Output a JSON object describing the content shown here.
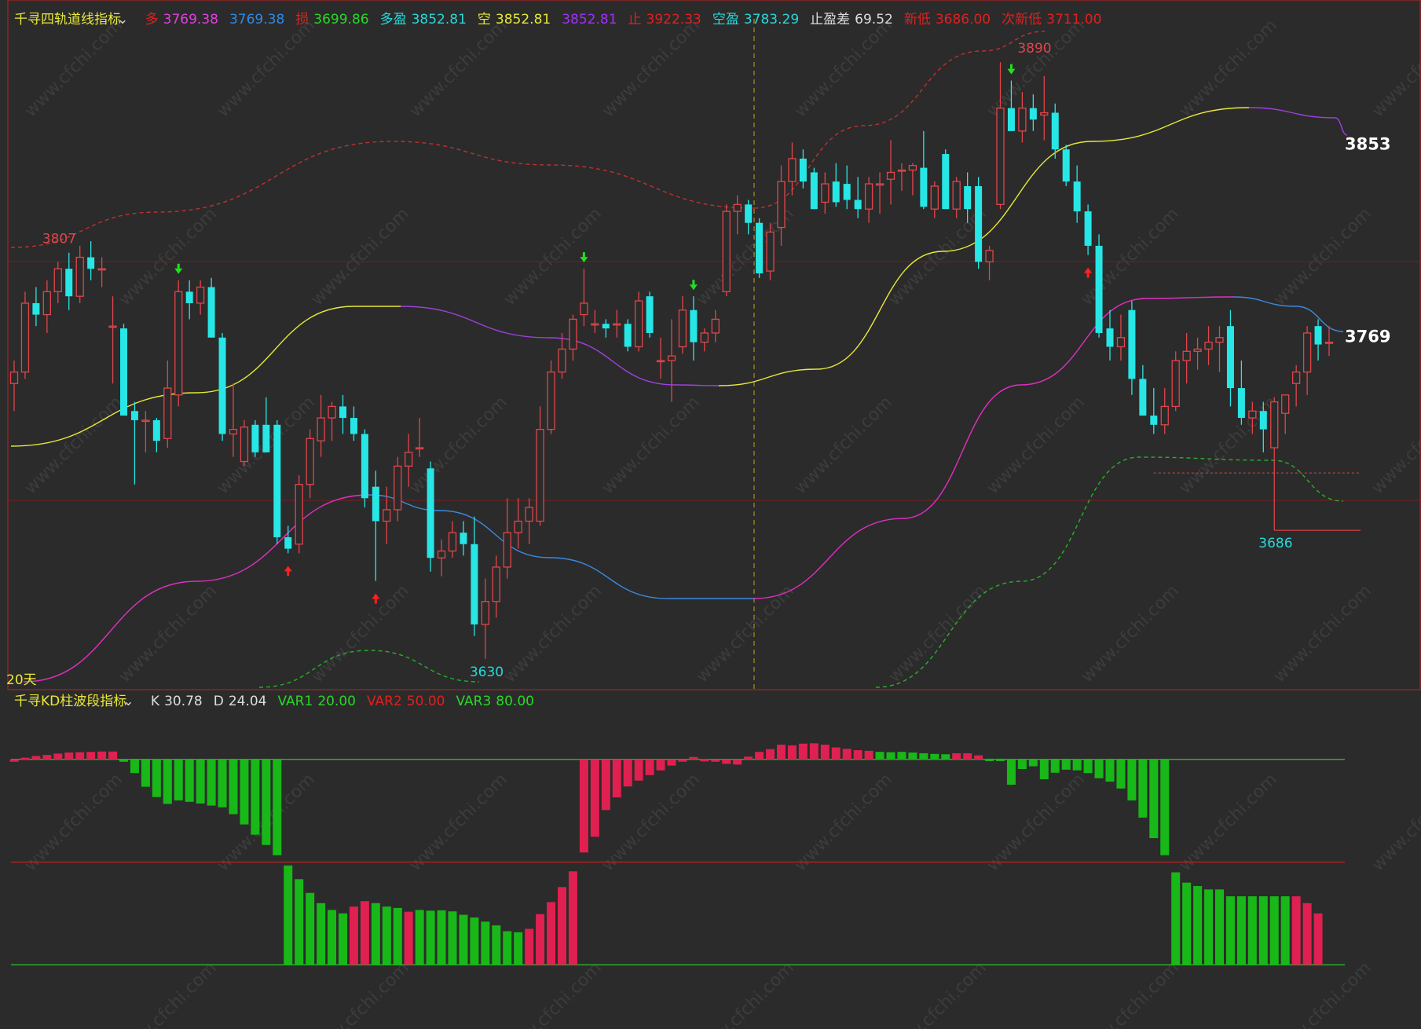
{
  "main_header": {
    "indicator_name": "千寻四轨道线指标",
    "values": [
      {
        "label": "多",
        "value": "3769.38",
        "label_color": "#e02020",
        "value_color": "#e040e0"
      },
      {
        "label": "",
        "value": "3769.38",
        "label_color": "#e02020",
        "value_color": "#2e8ae6"
      },
      {
        "label": "损",
        "value": "3699.86",
        "label_color": "#e02020",
        "value_color": "#27d927"
      },
      {
        "label": "多盈",
        "value": "3852.81",
        "label_color": "#27d9d9",
        "value_color": "#27d9d9"
      },
      {
        "label": "空",
        "value": "3852.81",
        "label_color": "#e8e83a",
        "value_color": "#e8e83a"
      },
      {
        "label": "",
        "value": "3852.81",
        "label_color": "#a030ff",
        "value_color": "#a030ff"
      },
      {
        "label": "止",
        "value": "3922.33",
        "label_color": "#e02020",
        "value_color": "#e02020"
      },
      {
        "label": "空盈",
        "value": "3783.29",
        "label_color": "#27d9d9",
        "value_color": "#27d9d9"
      },
      {
        "label": "止盈差",
        "value": "69.52",
        "label_color": "#dddddd",
        "value_color": "#dddddd"
      },
      {
        "label": "新低",
        "value": "3686.00",
        "label_color": "#e02020",
        "value_color": "#e02020"
      },
      {
        "label": "次新低",
        "value": "3711.00",
        "label_color": "#e02020",
        "value_color": "#e02020"
      }
    ]
  },
  "kd_header": {
    "indicator_name": "千寻KD柱波段指标",
    "values": [
      {
        "label": "K",
        "value": "30.78",
        "label_color": "#dddddd",
        "value_color": "#dddddd"
      },
      {
        "label": "D",
        "value": "24.04",
        "label_color": "#dddddd",
        "value_color": "#dddddd"
      },
      {
        "label": "VAR1",
        "value": "20.00",
        "label_color": "#27d927",
        "value_color": "#27d927"
      },
      {
        "label": "VAR2",
        "value": "50.00",
        "label_color": "#e02020",
        "value_color": "#e02020"
      },
      {
        "label": "VAR3",
        "value": "80.00",
        "label_color": "#27d927",
        "value_color": "#27d927"
      }
    ]
  },
  "watermark": "www.cfchi.com",
  "colors": {
    "background": "#2b2b2b",
    "up_candle": "#e0454a",
    "down_candle": "#27e6e6",
    "kd_up": "#e02050",
    "kd_down": "#18b818",
    "grid_red": "#7a1f1f",
    "yellow_line": "#e8e83a",
    "purple_line": "#a040e0",
    "blue_line": "#3a8ae0",
    "magenta_line": "#e030c0",
    "dash_red": "#c03030",
    "dash_green": "#28b028",
    "buy_arrow": "#ff2020",
    "sell_arrow": "#20e020"
  },
  "chart_data": [
    {
      "type": "candlestick",
      "price_range": [
        3620,
        3900
      ],
      "period_label": "20天",
      "price_labels": [
        {
          "text": "3807",
          "index": 4,
          "price": 3807,
          "color": "#e0454a"
        },
        {
          "text": "3630",
          "index": 43,
          "price": 3630,
          "color": "#27d9d9"
        },
        {
          "text": "3890",
          "index": 93,
          "price": 3890,
          "color": "#e0454a"
        },
        {
          "text": "3686",
          "index": 115,
          "price": 3686,
          "color": "#27d9d9"
        }
      ],
      "right_labels": [
        {
          "text": "3853",
          "price": 3853
        },
        {
          "text": "3769",
          "price": 3769
        }
      ],
      "candles": [
        {
          "o": 3750,
          "h": 3760,
          "l": 3738,
          "c": 3755
        },
        {
          "o": 3755,
          "h": 3790,
          "l": 3752,
          "c": 3785
        },
        {
          "o": 3785,
          "h": 3792,
          "l": 3775,
          "c": 3780
        },
        {
          "o": 3780,
          "h": 3795,
          "l": 3772,
          "c": 3790
        },
        {
          "o": 3790,
          "h": 3803,
          "l": 3785,
          "c": 3800
        },
        {
          "o": 3800,
          "h": 3807,
          "l": 3782,
          "c": 3788
        },
        {
          "o": 3788,
          "h": 3810,
          "l": 3785,
          "c": 3805
        },
        {
          "o": 3805,
          "h": 3812,
          "l": 3795,
          "c": 3800
        },
        {
          "o": 3800,
          "h": 3805,
          "l": 3792,
          "c": 3800
        },
        {
          "o": 3775,
          "h": 3788,
          "l": 3750,
          "c": 3775
        },
        {
          "o": 3774,
          "h": 3776,
          "l": 3738,
          "c": 3736
        },
        {
          "o": 3738,
          "h": 3742,
          "l": 3706,
          "c": 3734
        },
        {
          "o": 3734,
          "h": 3738,
          "l": 3720,
          "c": 3734
        },
        {
          "o": 3734,
          "h": 3735,
          "l": 3720,
          "c": 3725
        },
        {
          "o": 3726,
          "h": 3760,
          "l": 3722,
          "c": 3748
        },
        {
          "o": 3745,
          "h": 3795,
          "l": 3740,
          "c": 3790
        },
        {
          "o": 3790,
          "h": 3795,
          "l": 3778,
          "c": 3785
        },
        {
          "o": 3785,
          "h": 3795,
          "l": 3780,
          "c": 3792
        },
        {
          "o": 3792,
          "h": 3796,
          "l": 3770,
          "c": 3770
        },
        {
          "o": 3770,
          "h": 3772,
          "l": 3725,
          "c": 3728
        },
        {
          "o": 3728,
          "h": 3750,
          "l": 3718,
          "c": 3730
        },
        {
          "o": 3716,
          "h": 3734,
          "l": 3714,
          "c": 3731
        },
        {
          "o": 3732,
          "h": 3734,
          "l": 3718,
          "c": 3720
        },
        {
          "o": 3732,
          "h": 3744,
          "l": 3720,
          "c": 3720
        },
        {
          "o": 3732,
          "h": 3734,
          "l": 3680,
          "c": 3683
        },
        {
          "o": 3683,
          "h": 3688,
          "l": 3676,
          "c": 3678
        },
        {
          "o": 3680,
          "h": 3710,
          "l": 3676,
          "c": 3706
        },
        {
          "o": 3706,
          "h": 3730,
          "l": 3700,
          "c": 3726
        },
        {
          "o": 3725,
          "h": 3745,
          "l": 3718,
          "c": 3735
        },
        {
          "o": 3735,
          "h": 3742,
          "l": 3725,
          "c": 3740
        },
        {
          "o": 3740,
          "h": 3745,
          "l": 3728,
          "c": 3735
        },
        {
          "o": 3735,
          "h": 3740,
          "l": 3725,
          "c": 3728
        },
        {
          "o": 3728,
          "h": 3730,
          "l": 3696,
          "c": 3700
        },
        {
          "o": 3705,
          "h": 3712,
          "l": 3664,
          "c": 3690
        },
        {
          "o": 3690,
          "h": 3705,
          "l": 3680,
          "c": 3695
        },
        {
          "o": 3695,
          "h": 3718,
          "l": 3690,
          "c": 3714
        },
        {
          "o": 3714,
          "h": 3728,
          "l": 3705,
          "c": 3720
        },
        {
          "o": 3722,
          "h": 3735,
          "l": 3718,
          "c": 3722
        },
        {
          "o": 3713,
          "h": 3716,
          "l": 3668,
          "c": 3674
        },
        {
          "o": 3674,
          "h": 3682,
          "l": 3666,
          "c": 3677
        },
        {
          "o": 3677,
          "h": 3690,
          "l": 3674,
          "c": 3685
        },
        {
          "o": 3685,
          "h": 3690,
          "l": 3675,
          "c": 3680
        },
        {
          "o": 3680,
          "h": 3692,
          "l": 3640,
          "c": 3645
        },
        {
          "o": 3645,
          "h": 3665,
          "l": 3630,
          "c": 3655
        },
        {
          "o": 3655,
          "h": 3675,
          "l": 3648,
          "c": 3670
        },
        {
          "o": 3670,
          "h": 3700,
          "l": 3665,
          "c": 3685
        },
        {
          "o": 3685,
          "h": 3700,
          "l": 3678,
          "c": 3690
        },
        {
          "o": 3690,
          "h": 3700,
          "l": 3680,
          "c": 3696
        },
        {
          "o": 3690,
          "h": 3740,
          "l": 3688,
          "c": 3730
        },
        {
          "o": 3730,
          "h": 3760,
          "l": 3728,
          "c": 3755
        },
        {
          "o": 3755,
          "h": 3772,
          "l": 3752,
          "c": 3765
        },
        {
          "o": 3765,
          "h": 3780,
          "l": 3760,
          "c": 3778
        },
        {
          "o": 3780,
          "h": 3800,
          "l": 3775,
          "c": 3785
        },
        {
          "o": 3776,
          "h": 3782,
          "l": 3772,
          "c": 3776
        },
        {
          "o": 3776,
          "h": 3778,
          "l": 3770,
          "c": 3774
        },
        {
          "o": 3776,
          "h": 3782,
          "l": 3770,
          "c": 3776
        },
        {
          "o": 3776,
          "h": 3778,
          "l": 3764,
          "c": 3766
        },
        {
          "o": 3766,
          "h": 3790,
          "l": 3764,
          "c": 3786
        },
        {
          "o": 3788,
          "h": 3790,
          "l": 3770,
          "c": 3772
        },
        {
          "o": 3760,
          "h": 3770,
          "l": 3752,
          "c": 3760
        },
        {
          "o": 3760,
          "h": 3778,
          "l": 3742,
          "c": 3762
        },
        {
          "o": 3766,
          "h": 3788,
          "l": 3763,
          "c": 3782
        },
        {
          "o": 3782,
          "h": 3788,
          "l": 3760,
          "c": 3768
        },
        {
          "o": 3768,
          "h": 3774,
          "l": 3764,
          "c": 3772
        },
        {
          "o": 3772,
          "h": 3782,
          "l": 3768,
          "c": 3778
        },
        {
          "o": 3790,
          "h": 3828,
          "l": 3788,
          "c": 3825
        },
        {
          "o": 3825,
          "h": 3832,
          "l": 3815,
          "c": 3828
        },
        {
          "o": 3828,
          "h": 3830,
          "l": 3815,
          "c": 3820
        },
        {
          "o": 3820,
          "h": 3822,
          "l": 3796,
          "c": 3798
        },
        {
          "o": 3799,
          "h": 3820,
          "l": 3795,
          "c": 3816
        },
        {
          "o": 3818,
          "h": 3845,
          "l": 3810,
          "c": 3838
        },
        {
          "o": 3838,
          "h": 3855,
          "l": 3832,
          "c": 3848
        },
        {
          "o": 3848,
          "h": 3852,
          "l": 3835,
          "c": 3838
        },
        {
          "o": 3842,
          "h": 3844,
          "l": 3826,
          "c": 3826
        },
        {
          "o": 3829,
          "h": 3842,
          "l": 3824,
          "c": 3837
        },
        {
          "o": 3838,
          "h": 3846,
          "l": 3827,
          "c": 3829
        },
        {
          "o": 3837,
          "h": 3845,
          "l": 3826,
          "c": 3830
        },
        {
          "o": 3830,
          "h": 3840,
          "l": 3822,
          "c": 3826
        },
        {
          "o": 3826,
          "h": 3840,
          "l": 3820,
          "c": 3837
        },
        {
          "o": 3837,
          "h": 3842,
          "l": 3824,
          "c": 3837
        },
        {
          "o": 3839,
          "h": 3856,
          "l": 3828,
          "c": 3842
        },
        {
          "o": 3843,
          "h": 3846,
          "l": 3834,
          "c": 3843
        },
        {
          "o": 3843,
          "h": 3846,
          "l": 3832,
          "c": 3845
        },
        {
          "o": 3844,
          "h": 3860,
          "l": 3826,
          "c": 3827
        },
        {
          "o": 3826,
          "h": 3838,
          "l": 3822,
          "c": 3836
        },
        {
          "o": 3850,
          "h": 3852,
          "l": 3826,
          "c": 3826
        },
        {
          "o": 3826,
          "h": 3840,
          "l": 3822,
          "c": 3838
        },
        {
          "o": 3836,
          "h": 3842,
          "l": 3820,
          "c": 3826
        },
        {
          "o": 3836,
          "h": 3840,
          "l": 3800,
          "c": 3803
        },
        {
          "o": 3803,
          "h": 3810,
          "l": 3795,
          "c": 3808
        },
        {
          "o": 3828,
          "h": 3890,
          "l": 3826,
          "c": 3870
        },
        {
          "o": 3870,
          "h": 3882,
          "l": 3860,
          "c": 3860
        },
        {
          "o": 3860,
          "h": 3877,
          "l": 3855,
          "c": 3870
        },
        {
          "o": 3870,
          "h": 3876,
          "l": 3860,
          "c": 3865
        },
        {
          "o": 3867,
          "h": 3884,
          "l": 3856,
          "c": 3868
        },
        {
          "o": 3868,
          "h": 3872,
          "l": 3848,
          "c": 3852
        },
        {
          "o": 3852,
          "h": 3854,
          "l": 3836,
          "c": 3838
        },
        {
          "o": 3838,
          "h": 3845,
          "l": 3820,
          "c": 3825
        },
        {
          "o": 3825,
          "h": 3828,
          "l": 3806,
          "c": 3810
        },
        {
          "o": 3810,
          "h": 3815,
          "l": 3770,
          "c": 3772
        },
        {
          "o": 3774,
          "h": 3782,
          "l": 3760,
          "c": 3766
        },
        {
          "o": 3766,
          "h": 3780,
          "l": 3760,
          "c": 3770
        },
        {
          "o": 3782,
          "h": 3786,
          "l": 3745,
          "c": 3752
        },
        {
          "o": 3752,
          "h": 3758,
          "l": 3736,
          "c": 3736
        },
        {
          "o": 3736,
          "h": 3748,
          "l": 3728,
          "c": 3732
        },
        {
          "o": 3732,
          "h": 3748,
          "l": 3728,
          "c": 3740
        },
        {
          "o": 3740,
          "h": 3764,
          "l": 3738,
          "c": 3760
        },
        {
          "o": 3760,
          "h": 3772,
          "l": 3750,
          "c": 3764
        },
        {
          "o": 3764,
          "h": 3770,
          "l": 3756,
          "c": 3765
        },
        {
          "o": 3765,
          "h": 3775,
          "l": 3758,
          "c": 3768
        },
        {
          "o": 3768,
          "h": 3775,
          "l": 3755,
          "c": 3770
        },
        {
          "o": 3775,
          "h": 3782,
          "l": 3740,
          "c": 3748
        },
        {
          "o": 3748,
          "h": 3760,
          "l": 3732,
          "c": 3735
        },
        {
          "o": 3735,
          "h": 3742,
          "l": 3728,
          "c": 3738
        },
        {
          "o": 3738,
          "h": 3742,
          "l": 3720,
          "c": 3730
        },
        {
          "o": 3722,
          "h": 3744,
          "l": 3686,
          "c": 3742
        },
        {
          "o": 3737,
          "h": 3745,
          "l": 3728,
          "c": 3745
        },
        {
          "o": 3750,
          "h": 3758,
          "l": 3740,
          "c": 3755
        },
        {
          "o": 3755,
          "h": 3775,
          "l": 3745,
          "c": 3772
        },
        {
          "o": 3775,
          "h": 3778,
          "l": 3760,
          "c": 3767
        },
        {
          "o": 3768,
          "h": 3775,
          "l": 3762,
          "c": 3768
        }
      ],
      "buy_arrows": [
        25,
        33,
        98
      ],
      "sell_arrows": [
        15,
        52,
        62,
        91
      ]
    },
    {
      "type": "bar",
      "ylim": [
        15,
        85
      ],
      "reference_lines": [
        {
          "value": 80,
          "color": "#28c828"
        },
        {
          "value": 50,
          "color": "#c02020"
        },
        {
          "value": 20,
          "color": "#28c828"
        }
      ],
      "values": [
        80,
        80.5,
        81,
        81.3,
        81.7,
        82,
        82.1,
        82.2,
        82.3,
        82.3,
        80,
        76,
        72,
        69,
        67,
        68,
        67.6,
        67.1,
        66.5,
        66,
        64,
        61,
        58,
        55,
        52,
        49,
        45,
        41,
        38,
        36,
        35,
        37,
        38.6,
        38,
        37,
        36.6,
        35.5,
        36,
        35.8,
        35.9,
        35.6,
        34.6,
        33.8,
        32.6,
        31.5,
        29.8,
        29.5,
        30.5,
        34.8,
        38.3,
        42.7,
        47.3,
        52.8,
        57.4,
        65.2,
        68.9,
        72.1,
        73.8,
        75.4,
        76.8,
        78.2,
        79.7,
        80.7,
        80.1,
        79.5,
        78.7,
        78.5,
        80.8,
        82.2,
        83,
        84.3,
        84.1,
        84.6,
        84.7,
        84.3,
        83.5,
        83.1,
        82.7,
        82.5,
        82.2,
        82.1,
        82.2,
        82,
        81.8,
        81.6,
        81.5,
        81.8,
        81.8,
        81.2,
        80.2,
        80.2,
        72.6,
        77.2,
        78,
        74.2,
        76.1,
        77,
        76.8,
        76,
        74.5,
        73.5,
        71.5,
        68,
        63,
        57,
        52,
        47,
        44,
        43,
        42,
        42,
        40,
        40,
        40,
        40,
        40,
        40,
        40,
        38,
        35
      ],
      "up_flags": [
        1,
        1,
        1,
        1,
        1,
        1,
        1,
        1,
        1,
        1,
        0,
        0,
        0,
        0,
        0,
        0,
        0,
        0,
        0,
        0,
        0,
        0,
        0,
        0,
        0,
        0,
        0,
        0,
        0,
        0,
        0,
        1,
        1,
        0,
        0,
        0,
        1,
        0,
        0,
        0,
        0,
        0,
        0,
        0,
        0,
        0,
        0,
        1,
        1,
        1,
        1,
        1,
        1,
        1,
        1,
        1,
        1,
        1,
        1,
        1,
        1,
        1,
        1,
        1,
        1,
        1,
        1,
        1,
        1,
        1,
        1,
        1,
        1,
        1,
        1,
        1,
        1,
        1,
        1,
        0,
        0,
        0,
        0,
        0,
        0,
        0,
        1,
        1,
        1,
        0,
        0,
        0,
        0,
        0,
        0,
        0,
        0,
        0,
        0,
        0,
        0,
        0,
        0,
        0,
        0,
        0,
        0,
        0,
        0,
        0,
        0,
        0,
        0,
        0,
        0,
        0,
        0,
        1,
        1,
        1
      ]
    }
  ]
}
